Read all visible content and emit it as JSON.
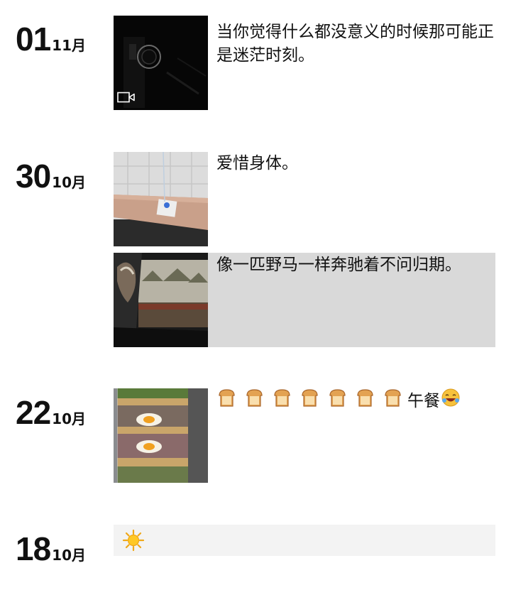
{
  "entries": [
    {
      "day": "01",
      "month": "11月",
      "posts": [
        {
          "text": "当你觉得什么都没意义的时候那可能正是迷茫时刻。",
          "media": "video",
          "media_icon": "video-camera-icon"
        }
      ]
    },
    {
      "day": "30",
      "month": "10月",
      "posts": [
        {
          "text": "爱惜身体。",
          "media": "photo"
        },
        {
          "text": "像一匹野马一样奔驰着不问归期。",
          "media": "photo"
        }
      ]
    },
    {
      "day": "22",
      "month": "10月",
      "posts": [
        {
          "text_suffix": "午餐",
          "bread_icon": "bread-icon",
          "bread_count": 7,
          "laugh_icon": "laughing-face-icon",
          "media": "photo"
        }
      ]
    },
    {
      "day": "18",
      "month": "10月",
      "posts": [
        {
          "icon": "sun-icon"
        }
      ]
    }
  ]
}
